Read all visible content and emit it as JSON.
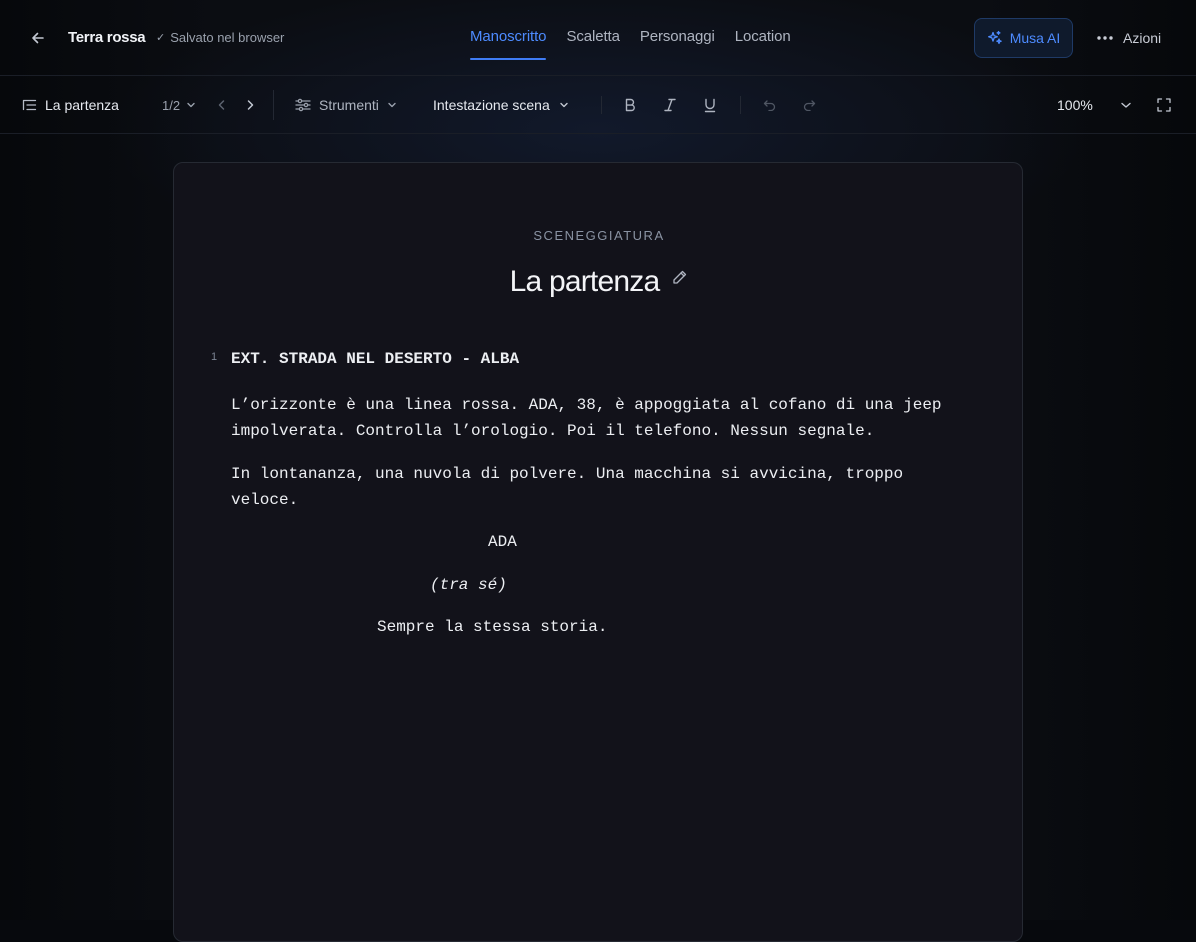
{
  "header": {
    "project_title": "Terra rossa",
    "save_status": "Salvato nel browser",
    "tabs": [
      {
        "label": "Manoscritto",
        "active": true
      },
      {
        "label": "Scaletta",
        "active": false
      },
      {
        "label": "Personaggi",
        "active": false
      },
      {
        "label": "Location",
        "active": false
      }
    ],
    "ai_button_label": "Musa AI",
    "actions_label": "Azioni"
  },
  "toolbar": {
    "scene_name": "La partenza",
    "scene_counter": "1/2",
    "tools_label": "Strumenti",
    "element_type": "Intestazione scena",
    "zoom": "100%"
  },
  "document": {
    "kicker": "SCENEGGIATURA",
    "title": "La partenza",
    "line_number": "1",
    "scene_heading": "EXT. STRADA NEL DESERTO - ALBA",
    "action_1": "L’orizzonte è una linea rossa. ADA, 38, è appoggiata al cofano di una jeep impolverata. Controlla l’orologio. Poi il telefono. Nessun segnale.",
    "action_2": "In lontananza, una nuvola di polvere. Una macchina si avvicina, troppo veloce.",
    "character": "ADA",
    "parenthetical": "(tra sé)",
    "dialogue": "Sempre la stessa storia."
  },
  "colors": {
    "accent": "#4d8bff",
    "background": "#0b0d12",
    "page": "#12121a"
  }
}
